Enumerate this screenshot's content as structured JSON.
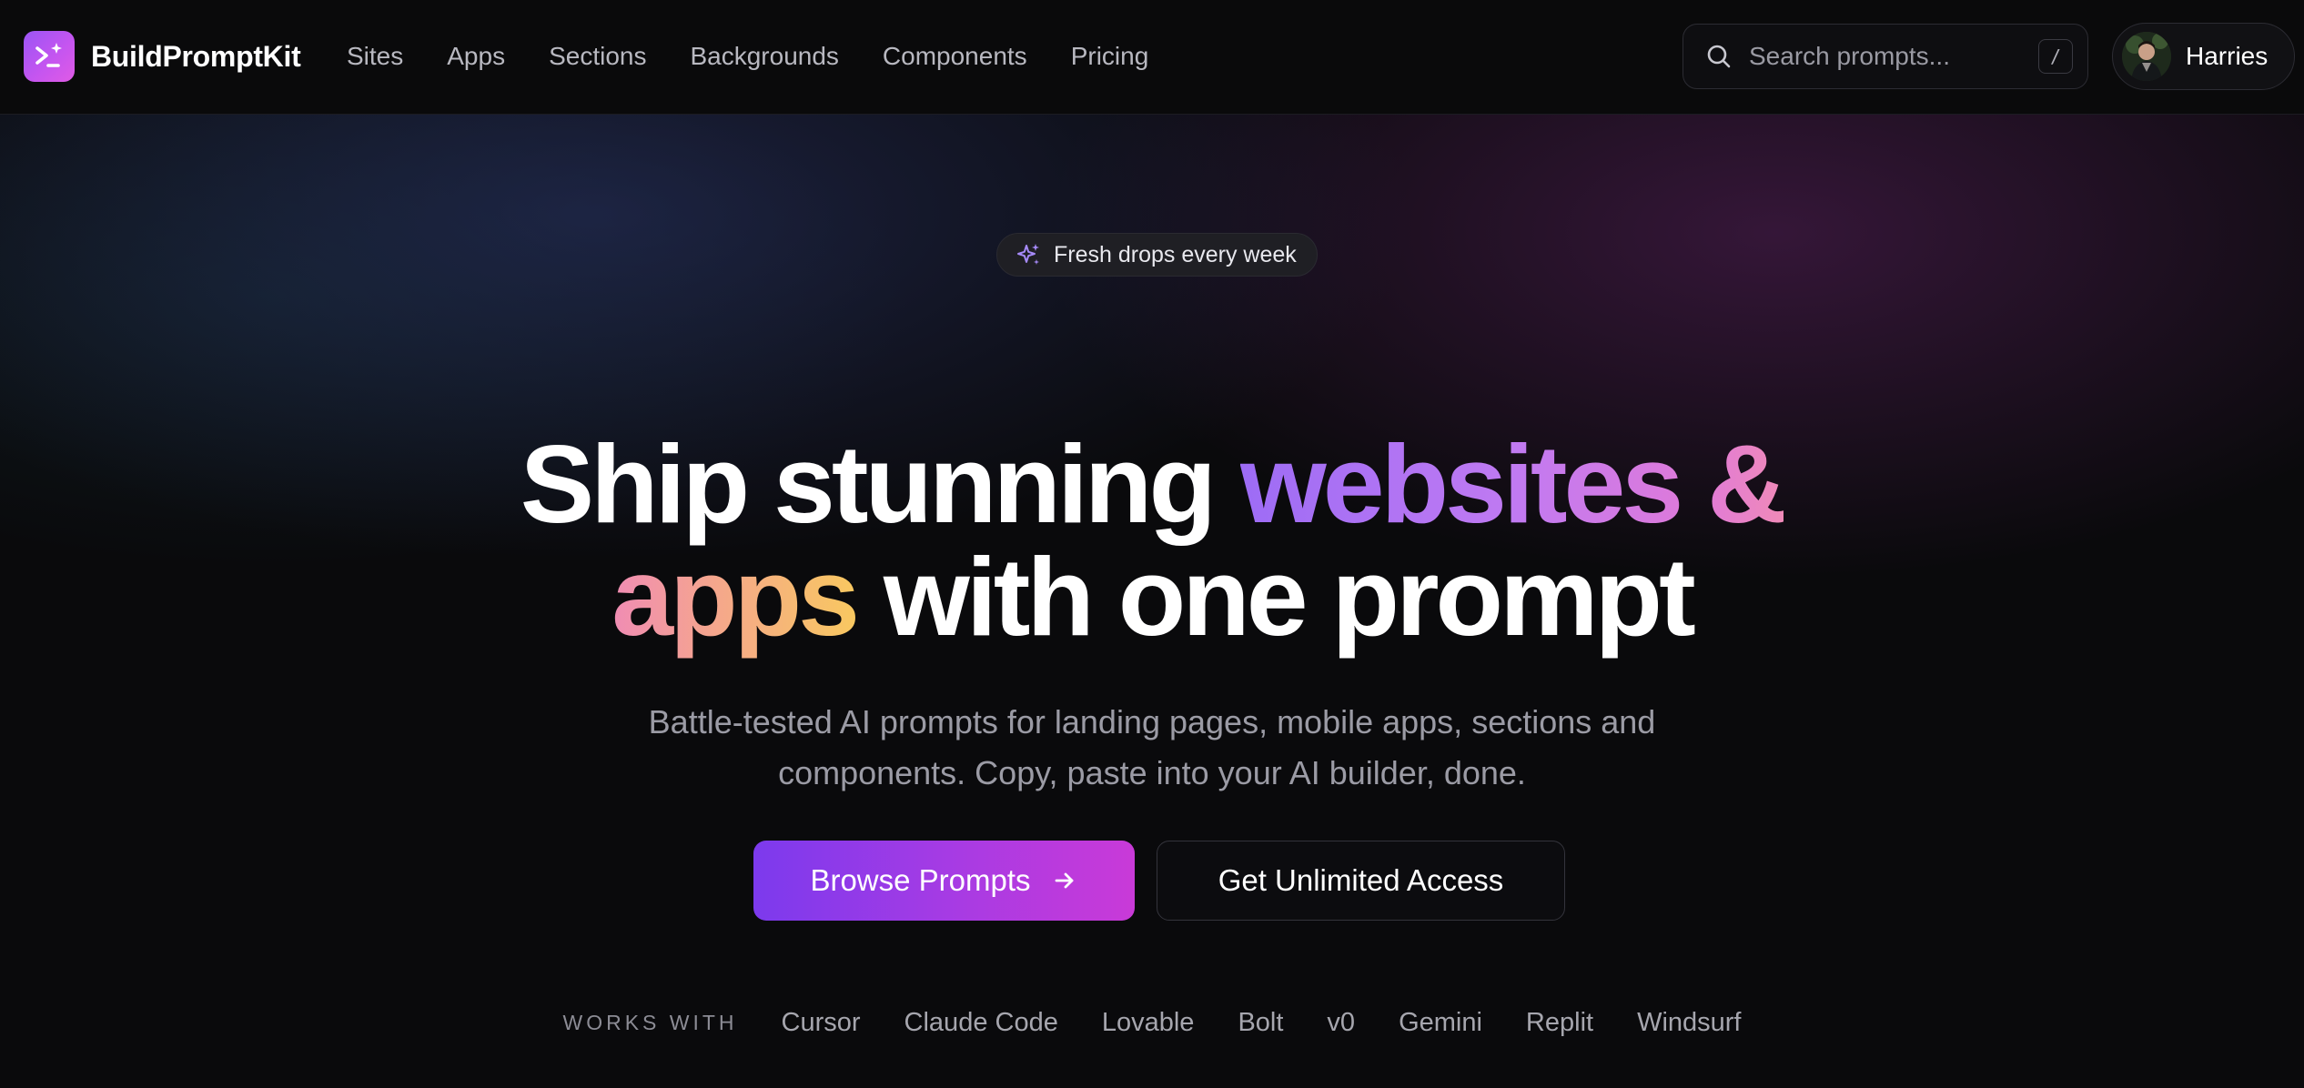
{
  "brand": {
    "name": "BuildPromptKit",
    "accent": "#a855f7"
  },
  "nav": {
    "items": [
      {
        "label": "Sites"
      },
      {
        "label": "Apps"
      },
      {
        "label": "Sections"
      },
      {
        "label": "Backgrounds"
      },
      {
        "label": "Components"
      },
      {
        "label": "Pricing"
      }
    ]
  },
  "search": {
    "placeholder": "Search prompts...",
    "value": "",
    "shortcut": "/",
    "icon": "search-icon"
  },
  "user": {
    "name": "Harries",
    "icon": "avatar"
  },
  "hero": {
    "badge": {
      "icon": "sparkles-icon",
      "text": "Fresh drops every week"
    },
    "headline": {
      "part1": "Ship stunning ",
      "highlight1": "websites &",
      "highlight2": "apps",
      "part2": " with one prompt"
    },
    "subtitle_line1": "Battle-tested AI prompts for landing pages, mobile apps, sections and",
    "subtitle_line2": "components. Copy, paste into your AI builder, done.",
    "primary_cta": {
      "label": "Browse Prompts",
      "icon": "arrow-right-icon",
      "gradient": [
        "#7c3aed",
        "#c93ad8"
      ]
    },
    "secondary_cta": {
      "label": "Get Unlimited Access"
    }
  },
  "works_with": {
    "label": "WORKS WITH",
    "items": [
      "Cursor",
      "Claude Code",
      "Lovable",
      "Bolt",
      "v0",
      "Gemini",
      "Replit",
      "Windsurf"
    ]
  }
}
